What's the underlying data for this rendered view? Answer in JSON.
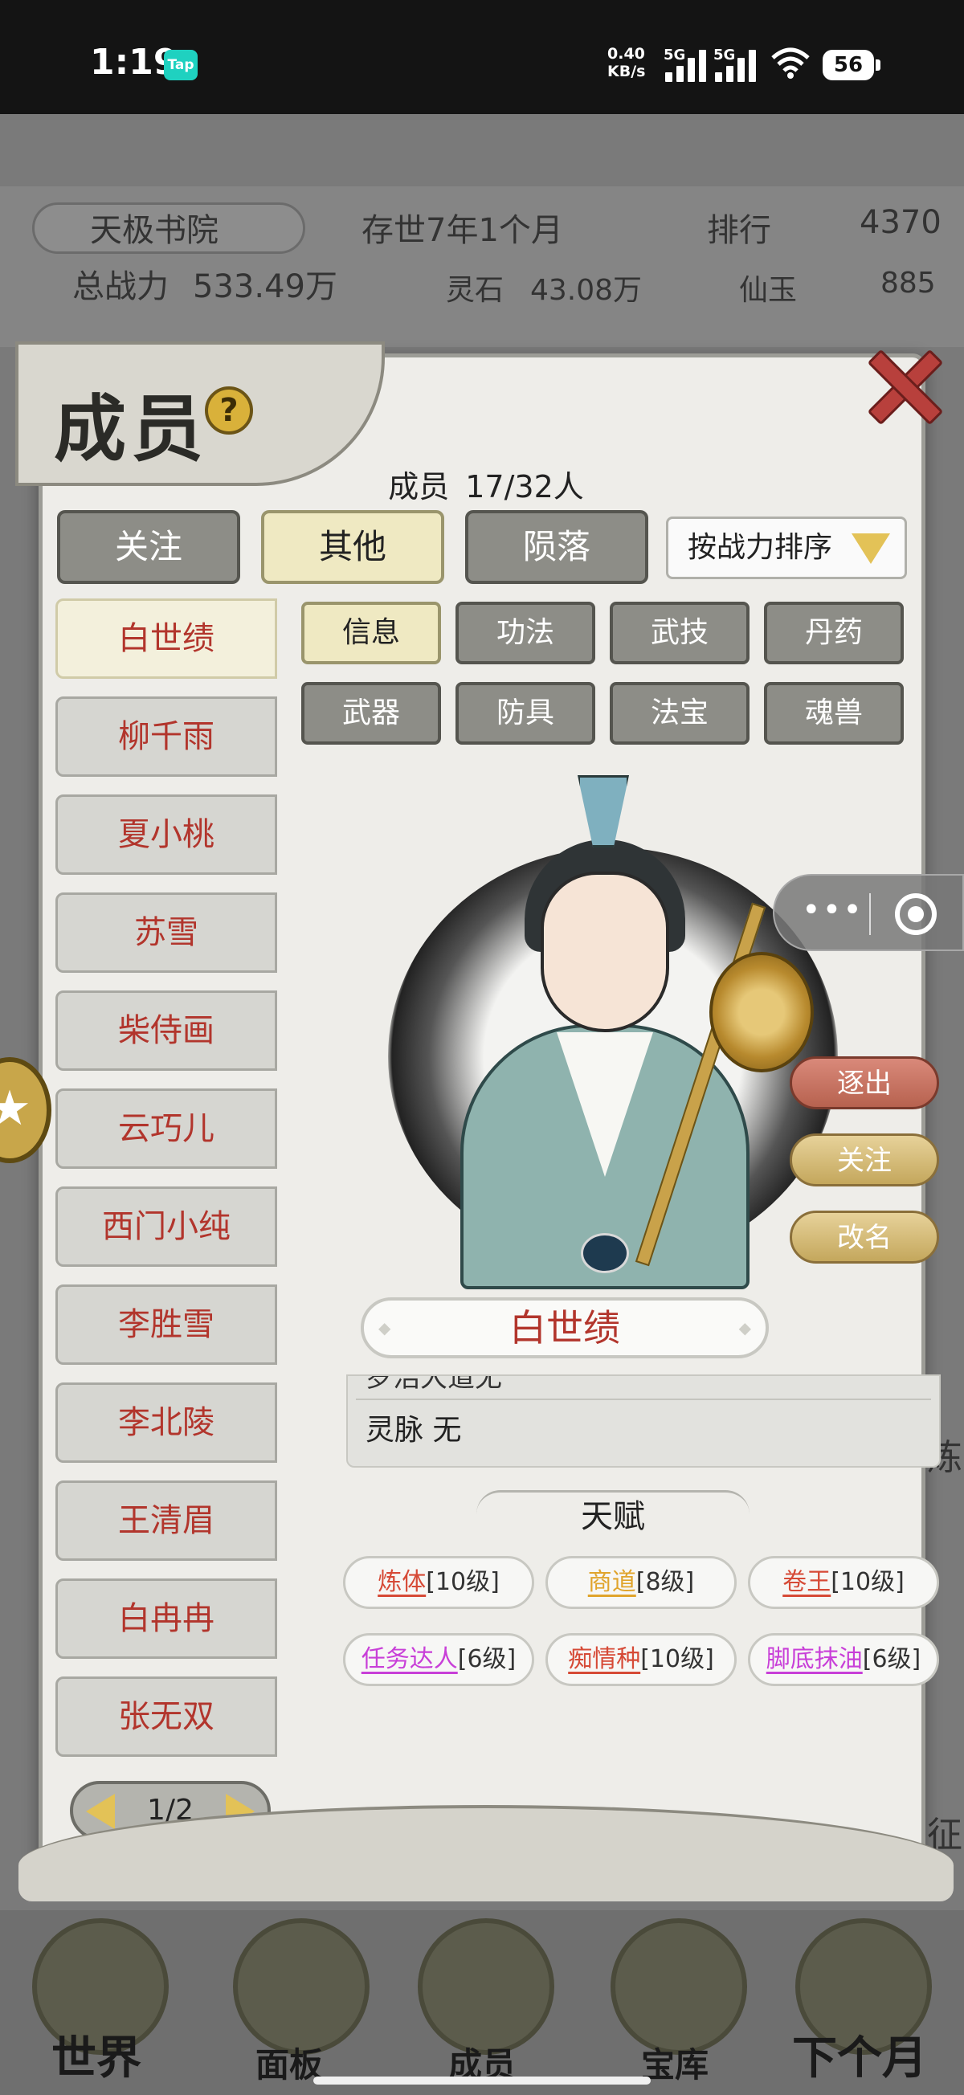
{
  "status_bar": {
    "time": "1:19",
    "app_badge": "Tap",
    "net_speed": "0.40",
    "net_unit": "KB/s",
    "sim1": "5G",
    "sim2": "5G",
    "battery": "56"
  },
  "background": {
    "sect_name": "天极书院",
    "age": "存世7年1个月",
    "rank_label": "排行",
    "rank_value": "4370",
    "power_label": "总战力",
    "power_value": "533.49万",
    "stone_label": "灵石",
    "stone_value": "43.08万",
    "jade_label": "仙玉",
    "jade_value": "885",
    "side_char": "炼",
    "side_char2": "征",
    "nav": [
      "世界",
      "面板",
      "成员",
      "宝库",
      "下个月"
    ]
  },
  "dialog": {
    "title": "成员",
    "help": "?",
    "member_count_label": "成员",
    "member_count_value": "17/32人",
    "filter_tabs": [
      "关注",
      "其他",
      "陨落"
    ],
    "sort_label": "按战力排序",
    "members": [
      "白世绩",
      "柳千雨",
      "夏小桃",
      "苏雪",
      "柴侍画",
      "云巧儿",
      "西门小纯",
      "李胜雪",
      "李北陵",
      "王清眉",
      "白冉冉",
      "张无双"
    ],
    "pager": "1/2",
    "detail_tabs": [
      "信息",
      "功法",
      "武技",
      "丹药",
      "武器",
      "防具",
      "法宝",
      "魂兽"
    ],
    "actions": {
      "expel": "逐出",
      "follow": "关注",
      "rename": "改名"
    },
    "selected_name": "白世绩",
    "info_cut_row": "罗浩大道无",
    "info_row": "灵脉 无",
    "talent_heading": "天赋",
    "talents": [
      {
        "name": "炼体",
        "level": "[10级]",
        "color": "#d64a36"
      },
      {
        "name": "商道",
        "level": "[8级]",
        "color": "#e0a42c"
      },
      {
        "name": "卷王",
        "level": "[10级]",
        "color": "#d64a36"
      },
      {
        "name": "任务达人",
        "level": "[6级]",
        "color": "#c83fd8"
      },
      {
        "name": "痴情种",
        "level": "[10级]",
        "color": "#d64a36"
      },
      {
        "name": "脚底抹油",
        "level": "[6级]",
        "color": "#c83fd8"
      }
    ]
  },
  "overlay": {
    "capsule_dots": "•••",
    "float_star": "★"
  }
}
